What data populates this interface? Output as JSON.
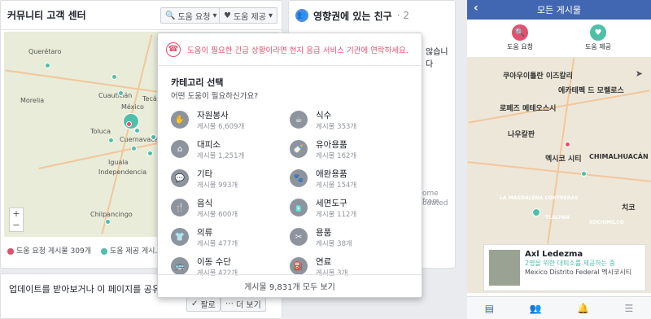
{
  "left_card": {
    "title": "커뮤니티 고객 센터",
    "request_btn": "도움 요청",
    "offer_btn": "도움 제공",
    "map_labels": [
      "Querétaro",
      "Morelia",
      "Toluca",
      "Cuautitlán",
      "Tecámac",
      "México",
      "Cuernavaca",
      "Iguala",
      "Independencia",
      "Chilpancingo"
    ],
    "legend_request": "도움 요청 게시물 309개",
    "legend_offer": "도움 제공 게시..."
  },
  "bottom_card": {
    "text": "업데이트를 받아보거나 이 페이지를 공유 ",
    "follow_label": "팔로",
    "more_label": "더 보기"
  },
  "mid_card": {
    "title": "영향권에 있는 친구",
    "count": "· 2",
    "text_fragment": "않습니다",
    "text_fragment2": "ome from",
    "text_fragment3": "odated"
  },
  "popup": {
    "alert": "도움이 필요한 긴급 상황이라면 현지 응급 서비스 기관에 연락하세요.",
    "category_title": "카테고리 선택",
    "category_sub": "어떤 도움이 필요하신가요?",
    "categories": [
      {
        "icon": "hand-icon",
        "glyph": "✋",
        "name": "자원봉사",
        "count": "게시물 6,609개"
      },
      {
        "icon": "cup-icon",
        "glyph": "☕",
        "name": "식수",
        "count": "게시물 353개"
      },
      {
        "icon": "home-icon",
        "glyph": "⌂",
        "name": "대피소",
        "count": "게시물 1,251개"
      },
      {
        "icon": "bottle-icon",
        "glyph": "🍼",
        "name": "유아용품",
        "count": "게시물 162개"
      },
      {
        "icon": "chat-icon",
        "glyph": "💬",
        "name": "기타",
        "count": "게시물 993개"
      },
      {
        "icon": "paw-icon",
        "glyph": "🐾",
        "name": "애완용품",
        "count": "게시물 154개"
      },
      {
        "icon": "fork-icon",
        "glyph": "🍴",
        "name": "음식",
        "count": "게시물 600개"
      },
      {
        "icon": "kit-icon",
        "glyph": "🧴",
        "name": "세면도구",
        "count": "게시물 112개"
      },
      {
        "icon": "shirt-icon",
        "glyph": "👕",
        "name": "의류",
        "count": "게시물 477개"
      },
      {
        "icon": "tools-icon",
        "glyph": "✂",
        "name": "용품",
        "count": "게시물 38개"
      },
      {
        "icon": "bus-icon",
        "glyph": "🚌",
        "name": "이동 수단",
        "count": "게시물 422개"
      },
      {
        "icon": "fuel-icon",
        "glyph": "⛽",
        "name": "연료",
        "count": "게시물 3개"
      }
    ],
    "see_all": "게시물 9,831개 모두 보기"
  },
  "phone": {
    "title": "모든 게시물",
    "request": "도움 요청",
    "offer": "도움 제공",
    "map_labels": [
      "쿠아우이틀란 이즈칼리",
      "에카테펙 드 모렐로스",
      "로페즈 메테오스시",
      "나우칼판",
      "멕시코 시티",
      "CHIMALHUACÁN",
      "치코",
      "LA MAGDALENA CONTRERAS",
      "TLALPAN",
      "XOCHIMILCO"
    ],
    "card_name": "Axl Ledezma",
    "card_desc": "2명을 위한 대피소를 제공하는 중",
    "card_loc": "Mexico Distrito Federal 멕시코시티"
  },
  "colors": {
    "request": "#e2506e",
    "offer": "#4fbfa8",
    "brand": "#4267b2"
  }
}
